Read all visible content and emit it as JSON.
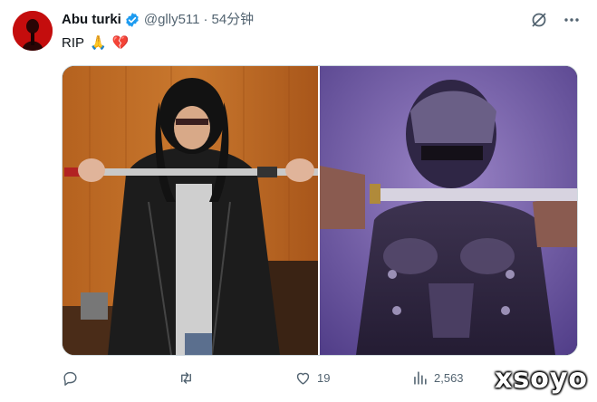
{
  "tweet": {
    "author_name": "Abu turki",
    "handle": "@glly511",
    "separator": "·",
    "time": "54分钟",
    "text": "RIP",
    "text_emojis": [
      "🙏",
      "💔"
    ]
  },
  "actions": {
    "reply_count": "",
    "retweet_count": "",
    "like_count": "19",
    "views_count": "2,563"
  },
  "watermark": "xsoyo",
  "colors": {
    "verified": "#1d9bf0",
    "secondary_text": "#536471",
    "avatar_bg": "#c40d0d"
  },
  "icons": [
    "verified-badge-icon",
    "grok-icon",
    "more-icon",
    "reply-icon",
    "retweet-icon",
    "like-icon",
    "views-icon"
  ]
}
